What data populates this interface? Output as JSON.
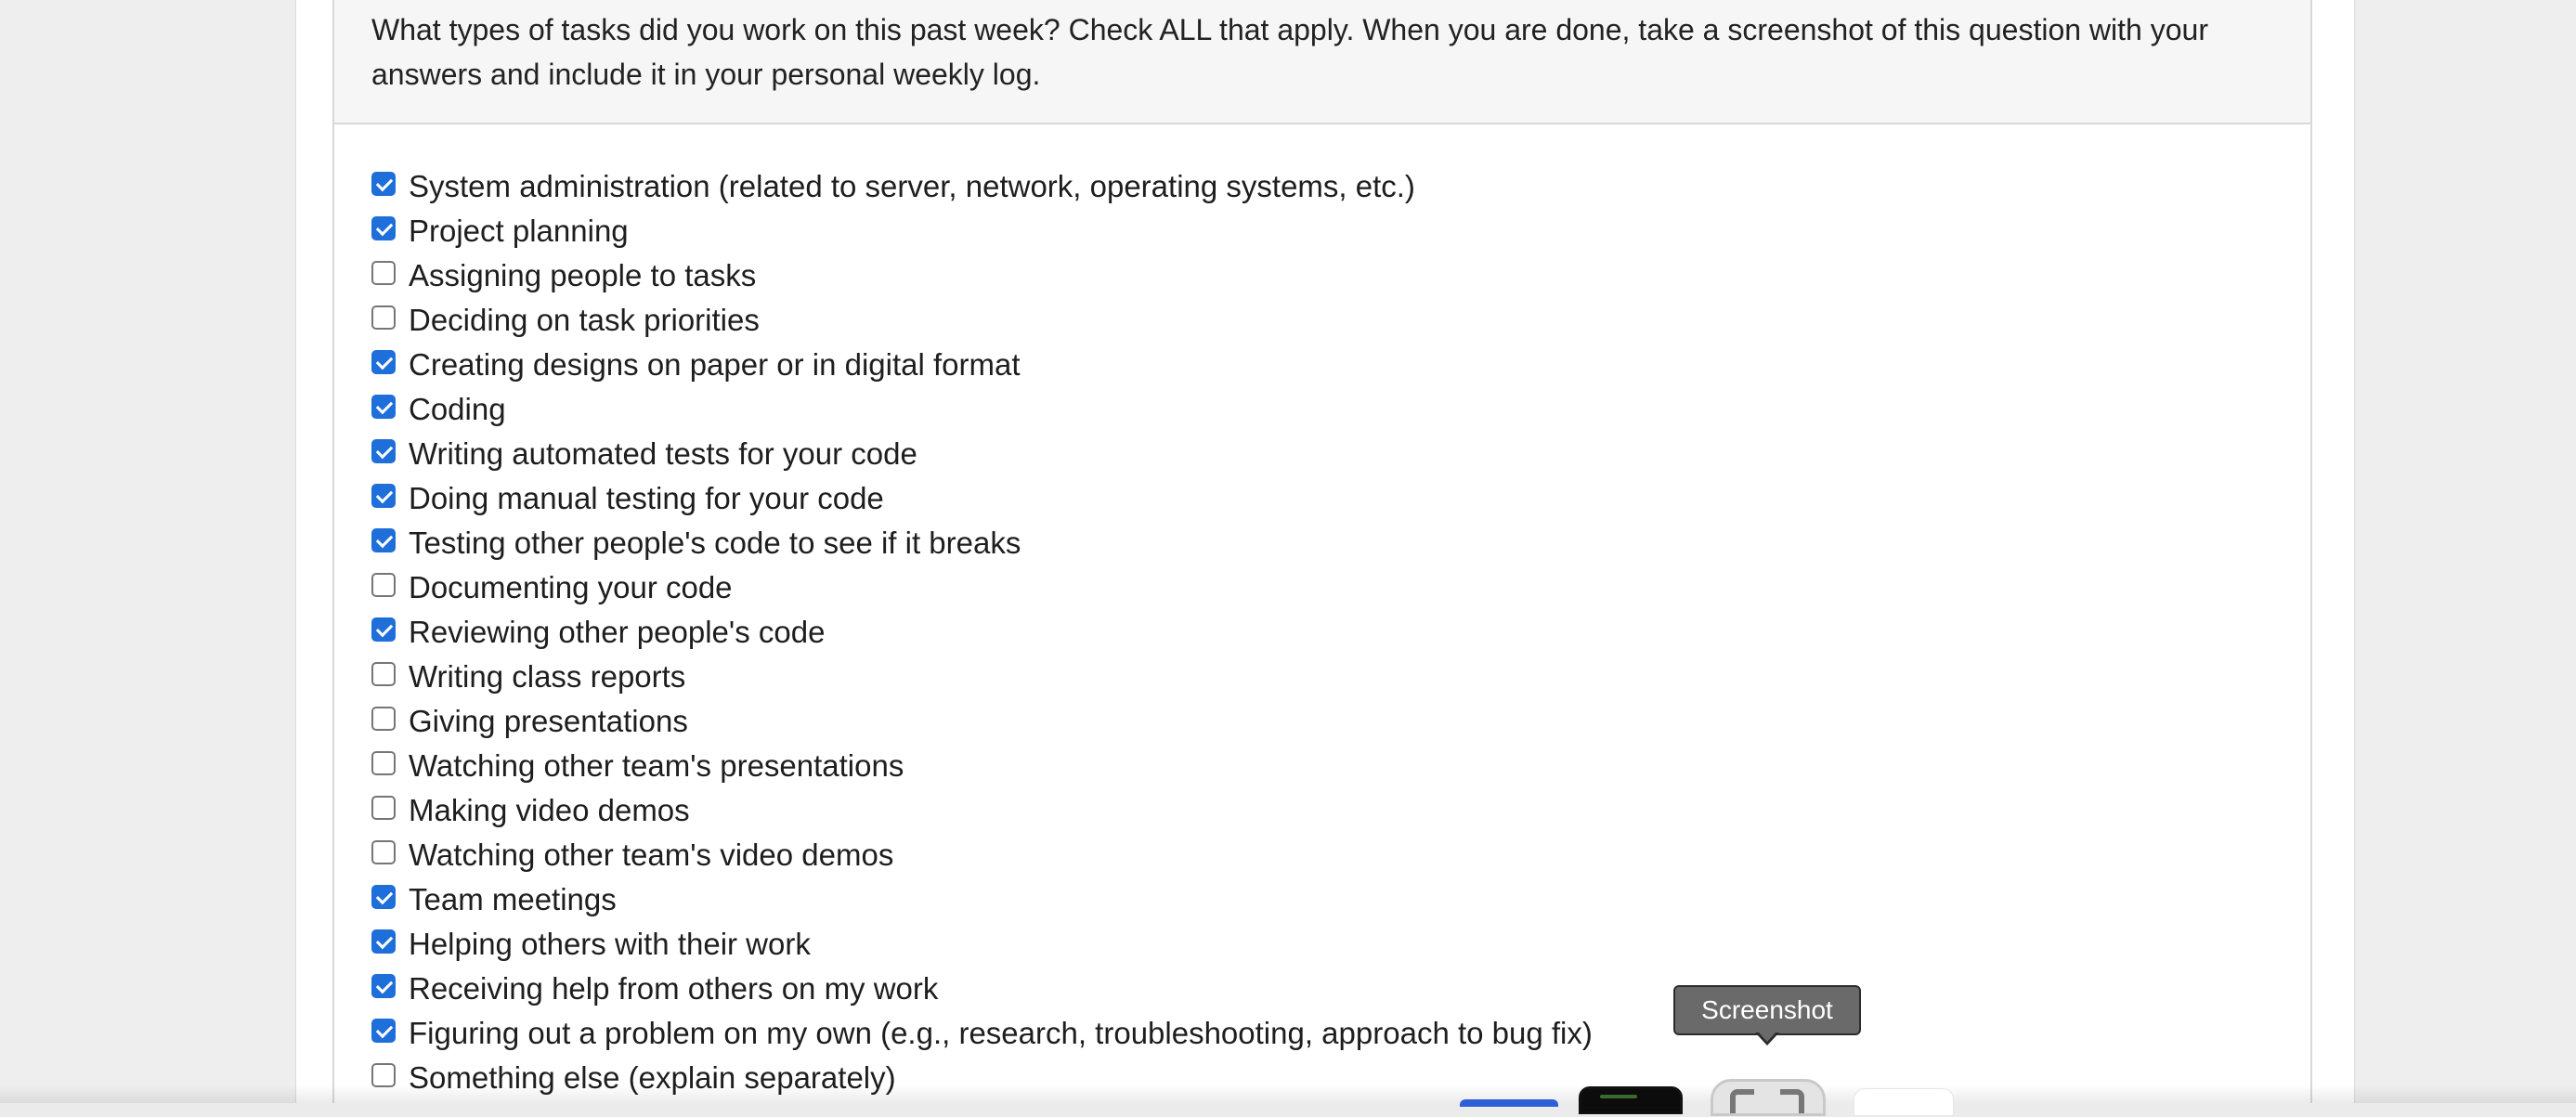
{
  "question": {
    "text": "What types of tasks did you work on this past week? Check ALL that apply. When you are done, take a screenshot of this question with your answers and include it in your personal weekly log."
  },
  "options": [
    {
      "label": "System administration (related to server, network, operating systems, etc.)",
      "checked": true
    },
    {
      "label": "Project planning",
      "checked": true
    },
    {
      "label": "Assigning people to tasks",
      "checked": false
    },
    {
      "label": "Deciding on task priorities",
      "checked": false
    },
    {
      "label": "Creating designs on paper or in digital format",
      "checked": true
    },
    {
      "label": "Coding",
      "checked": true
    },
    {
      "label": "Writing automated tests for your code",
      "checked": true
    },
    {
      "label": "Doing manual testing for your code",
      "checked": true
    },
    {
      "label": "Testing other people's code to see if it breaks",
      "checked": true
    },
    {
      "label": "Documenting your code",
      "checked": false
    },
    {
      "label": "Reviewing other people's code",
      "checked": true
    },
    {
      "label": "Writing class reports",
      "checked": false
    },
    {
      "label": "Giving presentations",
      "checked": false
    },
    {
      "label": "Watching other team's presentations",
      "checked": false
    },
    {
      "label": "Making video demos",
      "checked": false
    },
    {
      "label": "Watching other team's video demos",
      "checked": false
    },
    {
      "label": "Team meetings",
      "checked": true
    },
    {
      "label": "Helping others with their work",
      "checked": true
    },
    {
      "label": "Receiving help from others on my work",
      "checked": true
    },
    {
      "label": "Figuring out a problem on my own (e.g., research, troubleshooting, approach to bug fix)",
      "checked": true
    },
    {
      "label": "Something else (explain separately)",
      "checked": false
    }
  ],
  "tooltip": {
    "label": "Screenshot"
  },
  "colors": {
    "checkbox_checked": "#1f6fdb",
    "header_bg": "#f6f6f6",
    "page_bg": "#eeeeee",
    "tooltip_bg": "#6a6a6a"
  },
  "icons": {
    "dock_screenshot": "screenshot-icon"
  }
}
